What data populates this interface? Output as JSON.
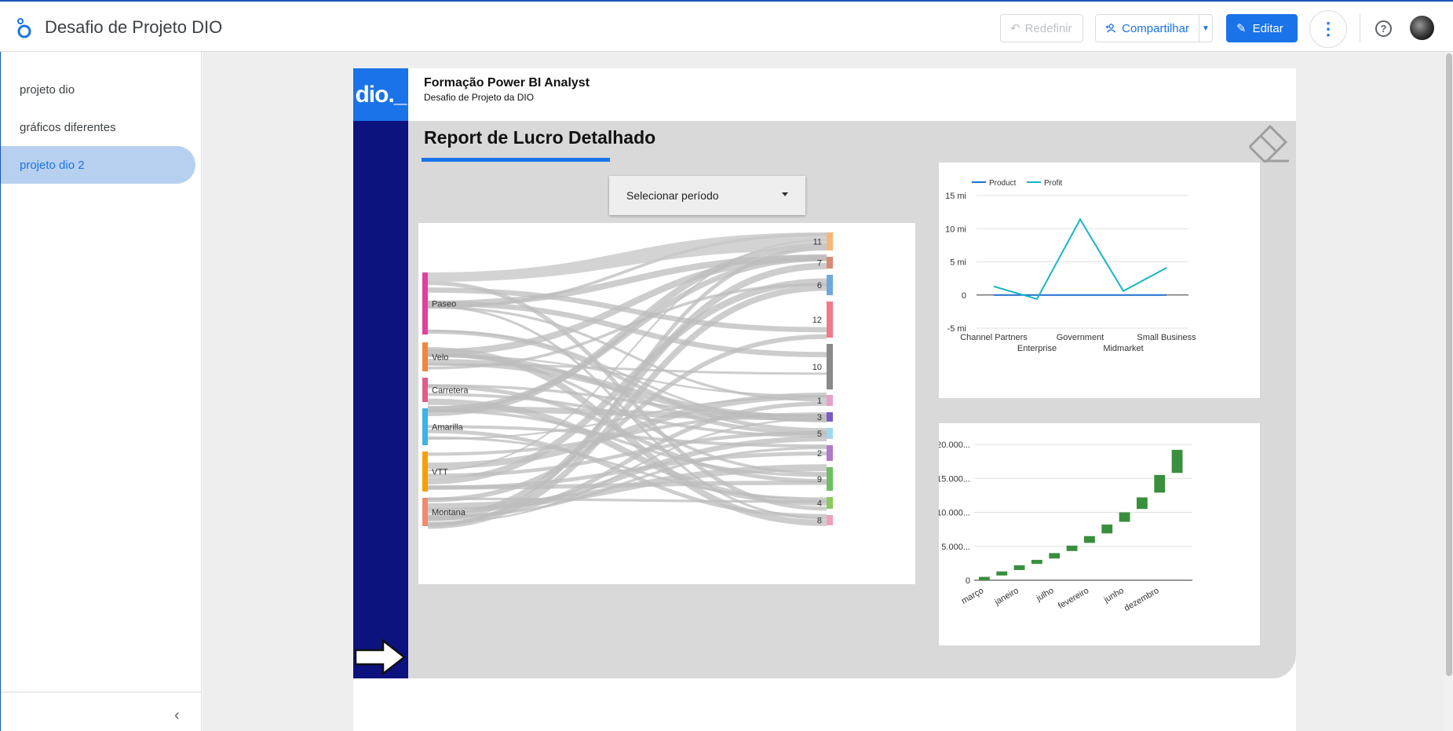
{
  "app": {
    "title": "Desafio de Projeto DIO",
    "reset_label": "Redefinir",
    "share_label": "Compartilhar",
    "edit_label": "Editar"
  },
  "sidebar": {
    "pages": [
      {
        "label": "projeto dio",
        "active": false
      },
      {
        "label": "gráficos diferentes",
        "active": false
      },
      {
        "label": "projeto dio 2",
        "active": true
      }
    ]
  },
  "report": {
    "logo_text": "dio._",
    "title": "Formação Power BI Analyst",
    "subtitle": "Desafio de Projeto da DIO",
    "heading": "Report de Lucro Detalhado",
    "period_select": "Selecionar período"
  },
  "colors": {
    "accent": "#1a73e8",
    "sidebar_dark": "#0c127e",
    "product_line": "#1f6fd0",
    "profit_line": "#17b5c4",
    "waterfall": "#3a8f3e"
  },
  "chart_data": [
    {
      "type": "sankey",
      "sources": [
        {
          "name": "Paseo",
          "color": "#e040a0"
        },
        {
          "name": "Velo",
          "color": "#f0883a"
        },
        {
          "name": "Carretera",
          "color": "#e05c8a"
        },
        {
          "name": "Amarilla",
          "color": "#3bb4e8"
        },
        {
          "name": "VTT",
          "color": "#f5a000"
        },
        {
          "name": "Montana",
          "color": "#f08a70"
        }
      ],
      "targets": [
        {
          "name": "11",
          "color": "#f7b77a"
        },
        {
          "name": "7",
          "color": "#d98a72"
        },
        {
          "name": "6",
          "color": "#6fa8dc"
        },
        {
          "name": "12",
          "color": "#f07a8a"
        },
        {
          "name": "10",
          "color": "#8a8a8a"
        },
        {
          "name": "1",
          "color": "#e8a0c8"
        },
        {
          "name": "3",
          "color": "#7a5cc8"
        },
        {
          "name": "5",
          "color": "#a0d8f0"
        },
        {
          "name": "2",
          "color": "#b07ac8"
        },
        {
          "name": "9",
          "color": "#6cc060"
        },
        {
          "name": "4",
          "color": "#8cc860"
        },
        {
          "name": "8",
          "color": "#f0a0b8"
        }
      ]
    },
    {
      "type": "line",
      "categories": [
        "Channel Partners",
        "Enterprise",
        "Government",
        "Midmarket",
        "Small Business"
      ],
      "series": [
        {
          "name": "Product",
          "values": [
            0,
            0,
            0,
            0,
            0
          ],
          "color": "#1f6fd0"
        },
        {
          "name": "Profit",
          "values": [
            1.3,
            -0.6,
            11.4,
            0.6,
            4.1
          ],
          "color": "#17b5c4"
        }
      ],
      "ylim": [
        -5,
        15
      ],
      "yticks": [
        "-5 mi",
        "0",
        "5 mi",
        "10 mi",
        "15 mi"
      ],
      "legend": "top-left"
    },
    {
      "type": "waterfall",
      "categories": [
        "março",
        "",
        "janeiro",
        "",
        "julho",
        "",
        "fevereiro",
        "",
        "junho",
        "",
        "dezembro",
        ""
      ],
      "bars": [
        [
          0,
          500
        ],
        [
          700,
          1300
        ],
        [
          1500,
          2200
        ],
        [
          2400,
          3000
        ],
        [
          3200,
          4000
        ],
        [
          4300,
          5100
        ],
        [
          5500,
          6500
        ],
        [
          6900,
          8200
        ],
        [
          8600,
          10000
        ],
        [
          10500,
          12200
        ],
        [
          12900,
          15500
        ],
        [
          15800,
          19200
        ]
      ],
      "ylim": [
        0,
        20000
      ],
      "yticks": [
        "0",
        "5.000...",
        "10.000...",
        "15.000...",
        "20.000..."
      ],
      "color": "#3a8f3e"
    }
  ]
}
